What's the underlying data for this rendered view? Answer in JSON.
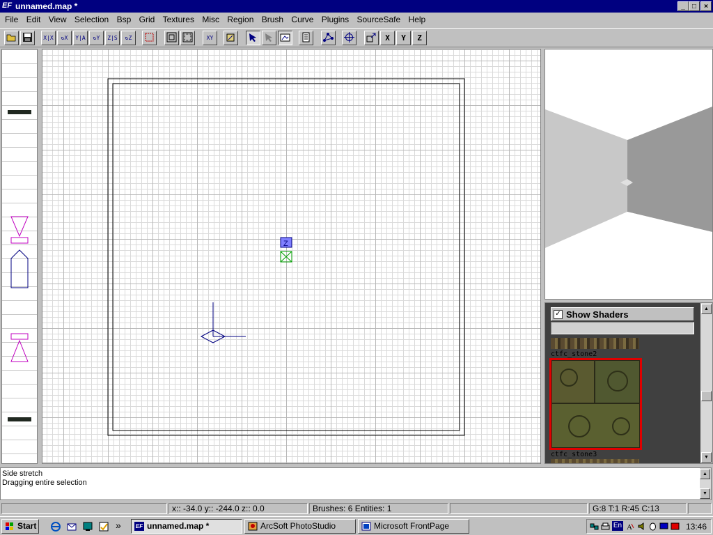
{
  "window": {
    "app_icon": "EF",
    "title": "unnamed.map *",
    "minimize_icon": "minimize-icon",
    "maximize_icon": "maximize-icon",
    "close_icon": "close-icon"
  },
  "menu": {
    "items": [
      "File",
      "Edit",
      "View",
      "Selection",
      "Bsp",
      "Grid",
      "Textures",
      "Misc",
      "Region",
      "Brush",
      "Curve",
      "Plugins",
      "SourceSafe",
      "Help"
    ]
  },
  "toolbar": {
    "icons": [
      "open-icon",
      "save-icon",
      "flip-x-icon",
      "rotate-x-icon",
      "flip-y-icon",
      "rotate-y-icon",
      "flip-z-icon",
      "rotate-z-icon",
      "select-complete-tall-icon",
      "csg-subtract-icon",
      "csg-merge-icon",
      "view-change-icon",
      "texture-icon",
      "clipper-icon",
      "select-touching-icon",
      "camera-icon",
      "entity-list-icon",
      "vertex-icon",
      "drag-mode-icon",
      "scale-icon",
      "x-axis-icon",
      "y-axis-icon",
      "z-axis-icon"
    ],
    "labels": {
      "xy": "XY",
      "x": "X",
      "y": "Y",
      "z": "Z"
    }
  },
  "xy_view": {
    "z_marker_label": "Z"
  },
  "texture_panel": {
    "show_shaders_label": "Show Shaders",
    "show_shaders_checked": true,
    "filter_value": "",
    "textures": [
      "ctfc_stone2",
      "ctfc_stone3"
    ],
    "selected_texture": "ctfc_stone2"
  },
  "console": {
    "lines": [
      "Side stretch",
      "Dragging entire selection"
    ]
  },
  "status": {
    "coords": "x:: -34.0  y:: -244.0  z:: 0.0",
    "brushes": "Brushes: 6  Entities: 1",
    "empty": "",
    "grid": "G:8  T:1  R:45  C:13"
  },
  "taskbar": {
    "start_label": "Start",
    "quicklaunch_icons": [
      "ie-icon",
      "outlook-icon",
      "desktop-icon",
      "channels-icon"
    ],
    "more_label": "»",
    "tasks": [
      {
        "label": "unnamed.map *",
        "icon": "ef-icon",
        "active": true
      },
      {
        "label": "ArcSoft PhotoStudio",
        "icon": "photostudio-icon",
        "active": false
      },
      {
        "label": "Microsoft FrontPage",
        "icon": "frontpage-icon",
        "active": false
      }
    ],
    "tray_lang": "En",
    "clock": "13:46"
  },
  "colors": {
    "title_bar": "#000080",
    "brush_outline": "#000000",
    "entity_magenta": "#c000c0",
    "camera_blue": "#000080",
    "selection_red": "#e00000"
  }
}
